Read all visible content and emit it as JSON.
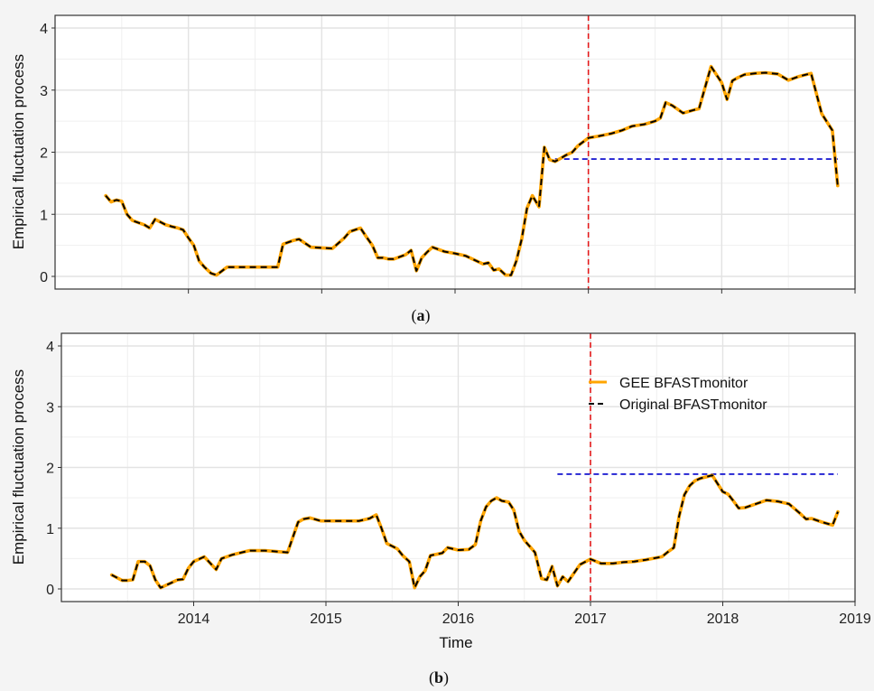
{
  "colors": {
    "gee": "#FFA500",
    "original": "#000000",
    "threshold": "#0000CC",
    "monitor_start": "#E41A1C",
    "grid": "#e3e3e3",
    "panel_bg": "#ffffff",
    "page_bg": "#f4f4f4"
  },
  "captions": {
    "a_open": "(",
    "a_letter": "a",
    "a_close": ")",
    "b_open": "(",
    "b_letter": "b",
    "b_close": ")"
  },
  "legend": {
    "gee_label": "GEE BFASTmonitor",
    "original_label": "Original BFASTmonitor"
  },
  "chart_data": [
    {
      "panel": "a",
      "type": "line",
      "ylabel": "Empirical fluctuation process",
      "xlabel": "",
      "xlim": [
        2013.0,
        2019.0
      ],
      "ylim": [
        0,
        4
      ],
      "yticks": [
        "0",
        "1",
        "2",
        "3",
        "4"
      ],
      "xticks": [],
      "x_tick_positions": [
        2014,
        2015,
        2016,
        2017,
        2018,
        2019
      ],
      "grid": true,
      "monitor_start": 2017,
      "threshold": {
        "value": 1.89,
        "x_start": 2016.75,
        "x_end": 2018.87
      },
      "series": [
        {
          "name": "GEE BFASTmonitor",
          "style": "solid",
          "x": [
            2013.38,
            2013.42,
            2013.46,
            2013.5,
            2013.54,
            2013.58,
            2013.67,
            2013.71,
            2013.75,
            2013.83,
            2013.88,
            2013.92,
            2013.96,
            2014.0,
            2014.04,
            2014.08,
            2014.12,
            2014.17,
            2014.21,
            2014.29,
            2014.42,
            2014.54,
            2014.67,
            2014.71,
            2014.79,
            2014.83,
            2014.92,
            2015.0,
            2015.08,
            2015.17,
            2015.21,
            2015.29,
            2015.33,
            2015.38,
            2015.42,
            2015.46,
            2015.5,
            2015.54,
            2015.63,
            2015.67,
            2015.71,
            2015.75,
            2015.79,
            2015.83,
            2015.92,
            2016.0,
            2016.08,
            2016.17,
            2016.21,
            2016.25,
            2016.29,
            2016.33,
            2016.38,
            2016.42,
            2016.46,
            2016.5,
            2016.54,
            2016.58,
            2016.63,
            2016.67,
            2016.71,
            2016.75,
            2016.79,
            2016.83,
            2016.88,
            2016.92,
            2017.0,
            2017.08,
            2017.17,
            2017.25,
            2017.33,
            2017.42,
            2017.5,
            2017.54,
            2017.58,
            2017.63,
            2017.71,
            2017.79,
            2017.83,
            2017.92,
            2018.0,
            2018.04,
            2018.08,
            2018.12,
            2018.17,
            2018.25,
            2018.33,
            2018.42,
            2018.5,
            2018.58,
            2018.67,
            2018.75,
            2018.83,
            2018.87
          ],
          "y": [
            1.3,
            1.2,
            1.23,
            1.21,
            1.0,
            0.9,
            0.83,
            0.78,
            0.92,
            0.83,
            0.8,
            0.78,
            0.75,
            0.62,
            0.5,
            0.25,
            0.15,
            0.05,
            0.02,
            0.15,
            0.15,
            0.15,
            0.15,
            0.52,
            0.58,
            0.6,
            0.47,
            0.46,
            0.45,
            0.62,
            0.72,
            0.78,
            0.65,
            0.5,
            0.3,
            0.3,
            0.28,
            0.28,
            0.35,
            0.42,
            0.09,
            0.3,
            0.39,
            0.47,
            0.4,
            0.37,
            0.33,
            0.24,
            0.2,
            0.22,
            0.1,
            0.12,
            0.02,
            0.02,
            0.25,
            0.6,
            1.1,
            1.3,
            1.12,
            2.08,
            1.88,
            1.85,
            1.9,
            1.95,
            2.0,
            2.1,
            2.23,
            2.26,
            2.3,
            2.35,
            2.42,
            2.45,
            2.5,
            2.55,
            2.8,
            2.75,
            2.63,
            2.68,
            2.7,
            3.38,
            3.12,
            2.85,
            3.15,
            3.2,
            3.25,
            3.27,
            3.28,
            3.26,
            3.16,
            3.22,
            3.27,
            2.62,
            2.35,
            1.46
          ]
        },
        {
          "name": "Original BFASTmonitor",
          "style": "dashed",
          "same_as": 0
        }
      ]
    },
    {
      "panel": "b",
      "type": "line",
      "ylabel": "Empirical fluctuation process",
      "xlabel": "Time",
      "xlim": [
        2013.0,
        2019.0
      ],
      "ylim": [
        0,
        4
      ],
      "yticks": [
        "0",
        "1",
        "2",
        "3",
        "4"
      ],
      "xticks": [
        "2014",
        "2015",
        "2016",
        "2017",
        "2018",
        "2019"
      ],
      "x_tick_positions": [
        2014,
        2015,
        2016,
        2017,
        2018,
        2019
      ],
      "grid": true,
      "legend_position": "top-right",
      "monitor_start": 2017,
      "threshold": {
        "value": 1.89,
        "x_start": 2016.75,
        "x_end": 2018.87
      },
      "series": [
        {
          "name": "GEE BFASTmonitor",
          "style": "solid",
          "x": [
            2013.38,
            2013.46,
            2013.5,
            2013.54,
            2013.58,
            2013.63,
            2013.67,
            2013.71,
            2013.75,
            2013.83,
            2013.88,
            2013.92,
            2013.96,
            2014.0,
            2014.08,
            2014.17,
            2014.21,
            2014.29,
            2014.42,
            2014.54,
            2014.71,
            2014.79,
            2014.83,
            2014.88,
            2014.96,
            2015.0,
            2015.08,
            2015.17,
            2015.25,
            2015.33,
            2015.38,
            2015.42,
            2015.46,
            2015.54,
            2015.58,
            2015.63,
            2015.67,
            2015.71,
            2015.75,
            2015.79,
            2015.88,
            2015.92,
            2016.0,
            2016.08,
            2016.13,
            2016.17,
            2016.21,
            2016.25,
            2016.29,
            2016.33,
            2016.38,
            2016.42,
            2016.46,
            2016.5,
            2016.58,
            2016.63,
            2016.67,
            2016.71,
            2016.75,
            2016.79,
            2016.83,
            2016.92,
            2017.0,
            2017.08,
            2017.17,
            2017.25,
            2017.33,
            2017.42,
            2017.54,
            2017.58,
            2017.63,
            2017.67,
            2017.71,
            2017.75,
            2017.79,
            2017.83,
            2017.92,
            2018.0,
            2018.04,
            2018.08,
            2018.12,
            2018.17,
            2018.25,
            2018.33,
            2018.42,
            2018.5,
            2018.58,
            2018.63,
            2018.67,
            2018.75,
            2018.83,
            2018.87
          ],
          "y": [
            0.23,
            0.14,
            0.14,
            0.15,
            0.45,
            0.45,
            0.38,
            0.15,
            0.02,
            0.1,
            0.15,
            0.16,
            0.34,
            0.45,
            0.53,
            0.32,
            0.5,
            0.56,
            0.63,
            0.63,
            0.6,
            1.1,
            1.15,
            1.17,
            1.12,
            1.12,
            1.12,
            1.12,
            1.12,
            1.16,
            1.22,
            1.0,
            0.75,
            0.66,
            0.55,
            0.45,
            0.02,
            0.2,
            0.3,
            0.55,
            0.59,
            0.68,
            0.64,
            0.65,
            0.73,
            1.12,
            1.35,
            1.45,
            1.5,
            1.45,
            1.43,
            1.3,
            0.95,
            0.8,
            0.6,
            0.17,
            0.15,
            0.37,
            0.05,
            0.2,
            0.12,
            0.4,
            0.49,
            0.42,
            0.42,
            0.44,
            0.45,
            0.48,
            0.53,
            0.6,
            0.68,
            1.2,
            1.55,
            1.7,
            1.78,
            1.82,
            1.87,
            1.6,
            1.56,
            1.45,
            1.33,
            1.34,
            1.4,
            1.46,
            1.44,
            1.4,
            1.25,
            1.15,
            1.16,
            1.1,
            1.05,
            1.27
          ]
        },
        {
          "name": "Original BFASTmonitor",
          "style": "dashed",
          "same_as": 0
        }
      ]
    }
  ]
}
